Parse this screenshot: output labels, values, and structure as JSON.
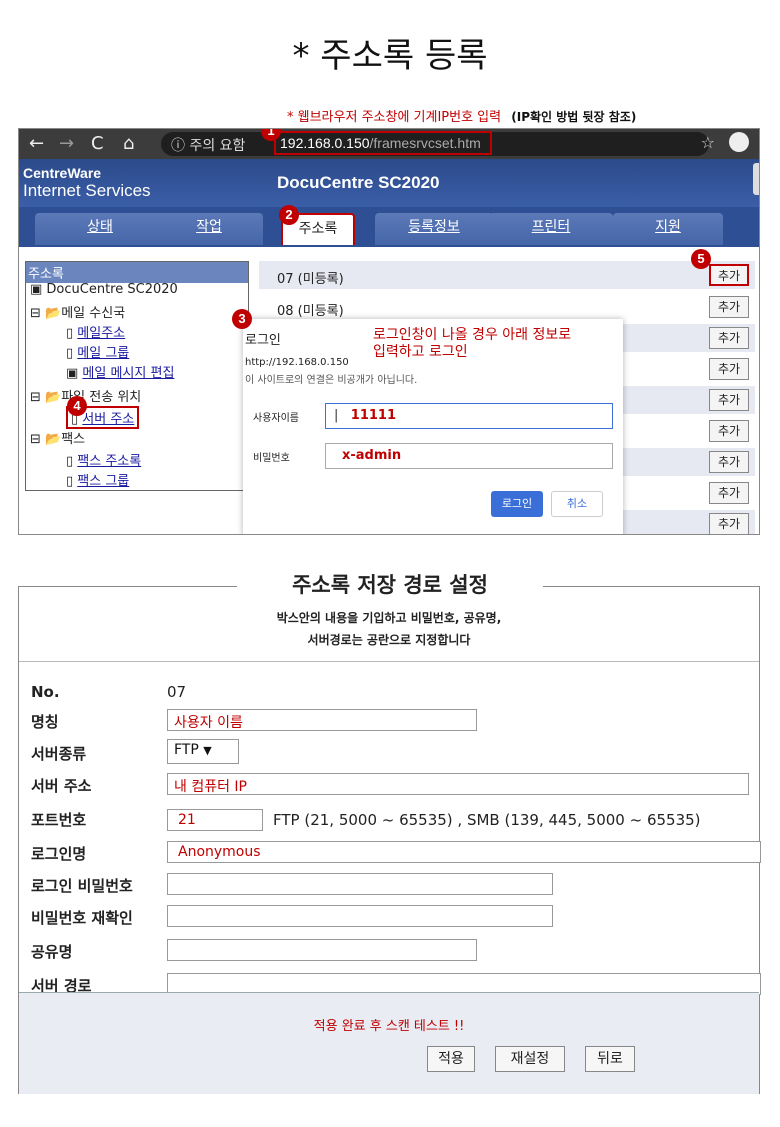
{
  "title": "* 주소록 등록",
  "note": "* 웹브라우저 주소창에 기계IP번호 입력",
  "note_sub": "(IP확인 방법 뒷장 참조)",
  "browser": {
    "info_label": "ⓘ 주의 요함",
    "url_host": "192.168.0.150",
    "url_path": "/framesrvcset.htm"
  },
  "app": {
    "logo_line1": "CentreWare",
    "logo_line2": "Internet Services",
    "model": "DocuCentre SC2020",
    "tabs": [
      "상태",
      "작업",
      "주소록",
      "등록정보",
      "프린터",
      "지원"
    ]
  },
  "tree": {
    "header": "주소록",
    "root": "DocuCentre SC2020",
    "mail_group": "메일 수신국",
    "mail_addr": "메일주소",
    "mail_grp": "메일 그룹",
    "mail_msg": "메일 메시지 편집",
    "file_send": "파일 전송 위치",
    "server_addr": "서버 주소",
    "fax": "팩스",
    "fax_addr": "팩스 주소록",
    "fax_grp": "팩스 그룹"
  },
  "rows": [
    {
      "label": "07 (미등록)",
      "btn": "추가"
    },
    {
      "label": "08 (미등록)",
      "btn": "추가"
    },
    {
      "label": "",
      "btn": "추가"
    },
    {
      "label": "",
      "btn": "추가"
    },
    {
      "label": "",
      "btn": "추가"
    },
    {
      "label": "",
      "btn": "추가"
    },
    {
      "label": "",
      "btn": "추가"
    },
    {
      "label": "",
      "btn": "추가"
    },
    {
      "label": "",
      "btn": "추가"
    }
  ],
  "login": {
    "title": "로그인",
    "url": "http://192.168.0.150",
    "warning": "이 사이트로의 연결은 비공개가 아닙니다.",
    "instruction_line1": "로그인창이 나올 경우 아래 정보로",
    "instruction_line2": "입력하고 로그인",
    "user_label": "사용자이름",
    "user_value": "11111",
    "pass_label": "비밀번호",
    "pass_value": "x-admin",
    "login_btn": "로그인",
    "cancel_btn": "취소"
  },
  "badges": [
    "1",
    "2",
    "3",
    "4",
    "5"
  ],
  "form": {
    "title": "주소록 저장 경로 설정",
    "desc_line1": "박스안의 내용을 기입하고 비밀번호, 공유명,",
    "desc_line2": "서버경로는 공란으로 지정합니다",
    "no_label": "No.",
    "no_value": "07",
    "name_label": "명칭",
    "name_value": "사용자 이름",
    "type_label": "서버종류",
    "type_value": "FTP",
    "addr_label": "서버 주소",
    "addr_value": "내 컴퓨터 IP",
    "port_label": "포트번호",
    "port_value": "21",
    "port_hint": "FTP (21, 5000 ~ 65535) ,  SMB (139, 445, 5000 ~ 65535)",
    "login_label": "로그인명",
    "login_value": "Anonymous",
    "pw_label": "로그인 비밀번호",
    "pw2_label": "비밀번호 재확인",
    "share_label": "공유명",
    "path_label": "서버 경로",
    "footer_note": "적용 완료 후 스캔 테스트 !!",
    "apply_btn": "적용",
    "reset_btn": "재설정",
    "back_btn": "뒤로"
  }
}
